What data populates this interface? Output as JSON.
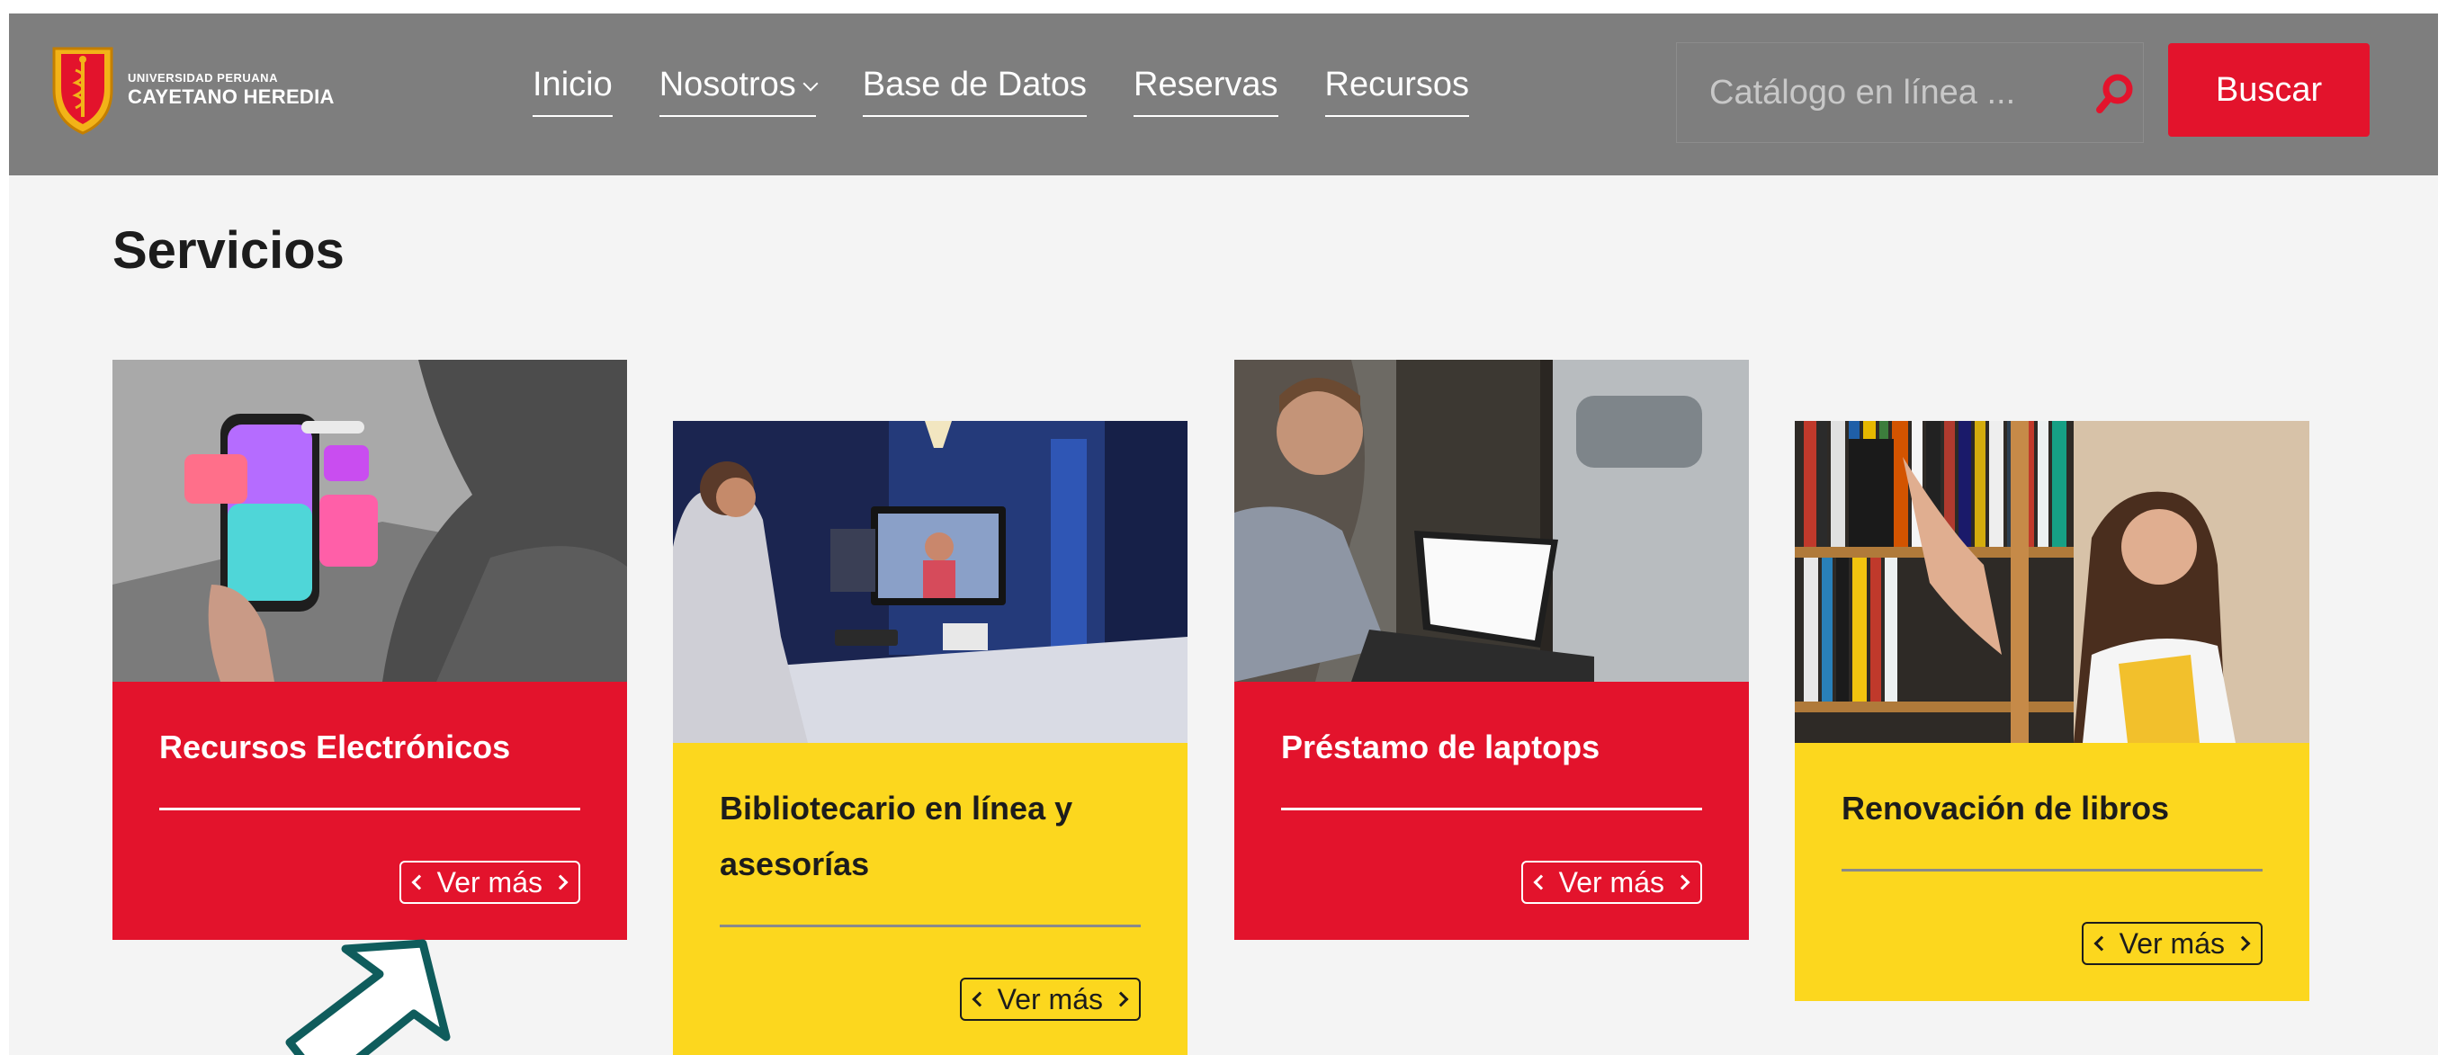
{
  "header": {
    "logo_top": "UNIVERSIDAD PERUANA",
    "logo_main": "CAYETANO HEREDIA",
    "nav": [
      {
        "label": "Inicio"
      },
      {
        "label": "Nosotros"
      },
      {
        "label": "Base de Datos"
      },
      {
        "label": "Reservas"
      },
      {
        "label": "Recursos"
      }
    ],
    "search_placeholder": "Catálogo en línea ...",
    "search_button": "Buscar"
  },
  "main": {
    "section_title": "Servicios",
    "cards": [
      {
        "title": "Recursos Electrónicos",
        "button": "Ver más",
        "theme": "red"
      },
      {
        "title": "Bibliotecario en línea y asesorías",
        "button": "Ver más",
        "theme": "yellow"
      },
      {
        "title": "Préstamo de laptops",
        "button": "Ver más",
        "theme": "red"
      },
      {
        "title": "Renovación de libros",
        "button": "Ver más",
        "theme": "yellow"
      }
    ]
  },
  "colors": {
    "header_bg": "#7e7e7e",
    "accent_red": "#e3132c",
    "accent_yellow": "#fcd71e",
    "arrow": "#0f5c5c"
  },
  "icons": [
    "university-crest-icon",
    "chevron-down-icon",
    "search-icon",
    "chevron-left-icon",
    "chevron-right-icon",
    "pointer-arrow-icon"
  ]
}
